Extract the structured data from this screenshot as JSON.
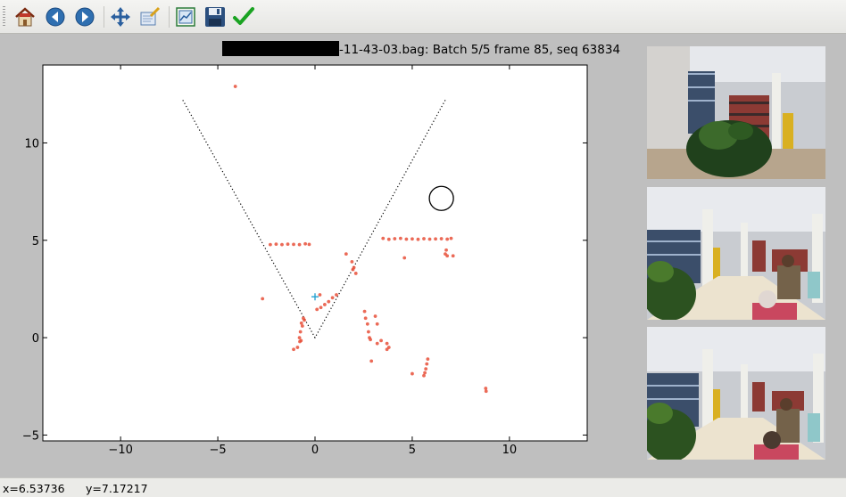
{
  "toolbar": {
    "icons": [
      "home-icon",
      "back-arrow-icon",
      "forward-arrow-icon",
      "pan-icon",
      "zoom-rectangle-icon",
      "subplot-configure-icon",
      "save-disk-icon",
      "checkmark-icon"
    ]
  },
  "figure": {
    "title_suffix": "-11-43-03.bag: Batch 5/5 frame 85, seq 63834"
  },
  "chart_data": {
    "type": "scatter",
    "title": "-11-43-03.bag: Batch 5/5 frame 85, seq 63834",
    "xlim": [
      -14,
      14
    ],
    "ylim": [
      -5.3,
      14
    ],
    "xticks": [
      -10,
      -5,
      0,
      5,
      10
    ],
    "yticks": [
      -5,
      0,
      5,
      10
    ],
    "xtick_labels": [
      "−10",
      "−5",
      "0",
      "5",
      "10"
    ],
    "ytick_labels": [
      "−5",
      "0",
      "5",
      "10"
    ],
    "grid": false,
    "point_color": "#e8503a",
    "fov_lines": [
      [
        -6.8,
        12.2
      ],
      [
        0,
        0
      ],
      [
        6.7,
        12.2
      ]
    ],
    "circle": {
      "x": 6.5,
      "y": 7.15,
      "r": 0.62
    },
    "marker": {
      "x": 0.0,
      "y": 2.1
    },
    "points": [
      [
        -4.1,
        12.9
      ],
      [
        -2.7,
        2.0
      ],
      [
        -2.3,
        4.78
      ],
      [
        -2.0,
        4.8
      ],
      [
        -1.7,
        4.78
      ],
      [
        -1.4,
        4.8
      ],
      [
        -1.1,
        4.79
      ],
      [
        -0.8,
        4.78
      ],
      [
        -0.5,
        4.82
      ],
      [
        -0.3,
        4.79
      ],
      [
        -0.55,
        0.9
      ],
      [
        -0.65,
        0.6
      ],
      [
        -0.75,
        0.3
      ],
      [
        -0.8,
        0.0
      ],
      [
        -0.78,
        -0.2
      ],
      [
        -0.72,
        -0.15
      ],
      [
        -0.7,
        0.75
      ],
      [
        -0.6,
        1.0
      ],
      [
        -1.1,
        -0.6
      ],
      [
        -0.9,
        -0.5
      ],
      [
        0.1,
        1.45
      ],
      [
        0.3,
        1.55
      ],
      [
        0.5,
        1.7
      ],
      [
        0.7,
        1.85
      ],
      [
        0.9,
        2.05
      ],
      [
        1.1,
        2.2
      ],
      [
        0.25,
        2.2
      ],
      [
        1.6,
        4.3
      ],
      [
        1.9,
        3.9
      ],
      [
        2.0,
        3.6
      ],
      [
        2.1,
        3.3
      ],
      [
        1.95,
        3.5
      ],
      [
        2.55,
        1.35
      ],
      [
        2.6,
        1.0
      ],
      [
        2.7,
        0.7
      ],
      [
        2.75,
        0.3
      ],
      [
        2.8,
        0.0
      ],
      [
        2.85,
        -0.1
      ],
      [
        3.1,
        1.1
      ],
      [
        3.2,
        0.7
      ],
      [
        3.2,
        -0.3
      ],
      [
        3.4,
        -0.15
      ],
      [
        3.7,
        -0.3
      ],
      [
        3.8,
        -0.5
      ],
      [
        2.9,
        -1.2
      ],
      [
        3.7,
        -0.6
      ],
      [
        3.5,
        5.1
      ],
      [
        3.8,
        5.05
      ],
      [
        4.1,
        5.08
      ],
      [
        4.4,
        5.1
      ],
      [
        4.7,
        5.06
      ],
      [
        5.0,
        5.07
      ],
      [
        5.3,
        5.05
      ],
      [
        5.6,
        5.08
      ],
      [
        5.9,
        5.06
      ],
      [
        6.2,
        5.07
      ],
      [
        6.5,
        5.08
      ],
      [
        6.8,
        5.06
      ],
      [
        7.0,
        5.1
      ],
      [
        4.6,
        4.1
      ],
      [
        6.7,
        4.3
      ],
      [
        6.75,
        4.5
      ],
      [
        6.8,
        4.2
      ],
      [
        7.1,
        4.2
      ],
      [
        5.8,
        -1.1
      ],
      [
        5.75,
        -1.35
      ],
      [
        5.7,
        -1.6
      ],
      [
        5.65,
        -1.8
      ],
      [
        5.6,
        -1.95
      ],
      [
        5.0,
        -1.85
      ],
      [
        8.8,
        -2.75
      ],
      [
        8.78,
        -2.6
      ]
    ]
  },
  "camera_views": [
    "camera-view-1",
    "camera-view-2",
    "camera-view-3"
  ],
  "status": {
    "x_readout": "x=6.53736",
    "y_readout": "y=7.17217"
  }
}
